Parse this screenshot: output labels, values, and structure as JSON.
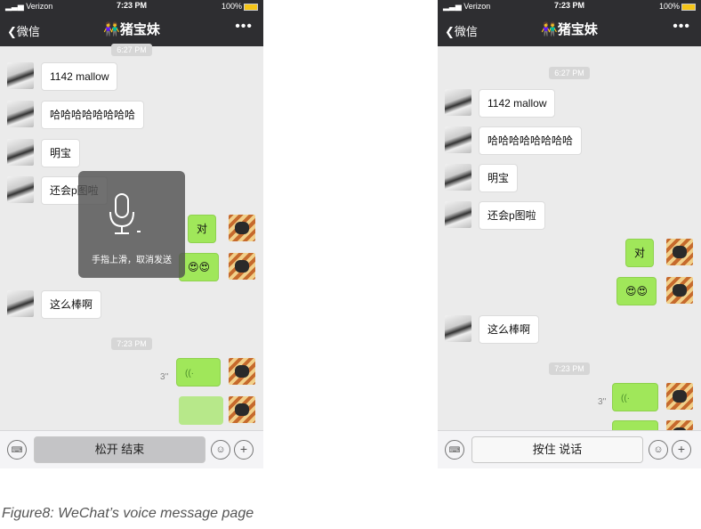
{
  "status": {
    "carrier": "Verizon",
    "time": "7:23 PM",
    "battery": "100%"
  },
  "nav": {
    "back_label": "微信",
    "title": "猪宝妹",
    "more_label": "•••"
  },
  "messages": [
    {
      "side": "in",
      "text": "1142 mallow"
    },
    {
      "side": "in",
      "text": "哈哈哈哈哈哈哈哈"
    },
    {
      "side": "in",
      "text": "明宝"
    },
    {
      "side": "in",
      "text": "还会p图啦"
    },
    {
      "side": "out",
      "text": "对"
    },
    {
      "side": "out",
      "text": "😍😍"
    },
    {
      "side": "in",
      "text": "这么棒啊"
    },
    {
      "side": "out",
      "voice_length": "3''"
    }
  ],
  "timestamps": {
    "first": "6:27 PM",
    "second": "7:23 PM"
  },
  "left_phone": {
    "hold_label": "松开 结束",
    "recording_hint": "手指上滑，取消发送"
  },
  "right_phone": {
    "hold_label": "按住 说话"
  },
  "caption": "Figure8: WeChat’s voice message page"
}
